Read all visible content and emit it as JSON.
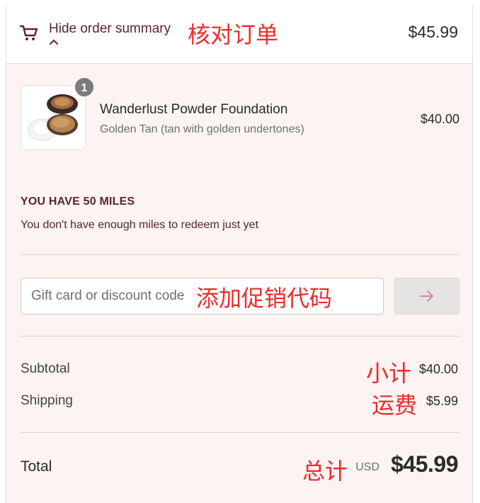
{
  "summary": {
    "toggle_label": "Hide order summary",
    "toggle_annotation": "核对订单",
    "total": "$45.99"
  },
  "product": {
    "quantity": "1",
    "name": "Wanderlust Powder Foundation",
    "variant": "Golden Tan (tan with golden undertones)",
    "price": "$40.00"
  },
  "miles": {
    "title": "YOU HAVE 50 MILES",
    "message": "You don't have enough miles to redeem just yet"
  },
  "discount": {
    "placeholder": "Gift card or discount code",
    "annotation": "添加促销代码"
  },
  "costs": {
    "subtotal_label": "Subtotal",
    "subtotal_annotation": "小计",
    "subtotal_value": "$40.00",
    "shipping_label": "Shipping",
    "shipping_annotation": "运费",
    "shipping_value": "$5.99",
    "total_label": "Total",
    "total_annotation": "总计",
    "currency": "USD",
    "total_value": "$45.99"
  },
  "colors": {
    "accent": "#5a2334",
    "background": "#fbf4f3",
    "annotation": "#ee2b2b"
  },
  "icons": [
    "cart-icon",
    "chevron-up-icon",
    "arrow-right-icon"
  ]
}
